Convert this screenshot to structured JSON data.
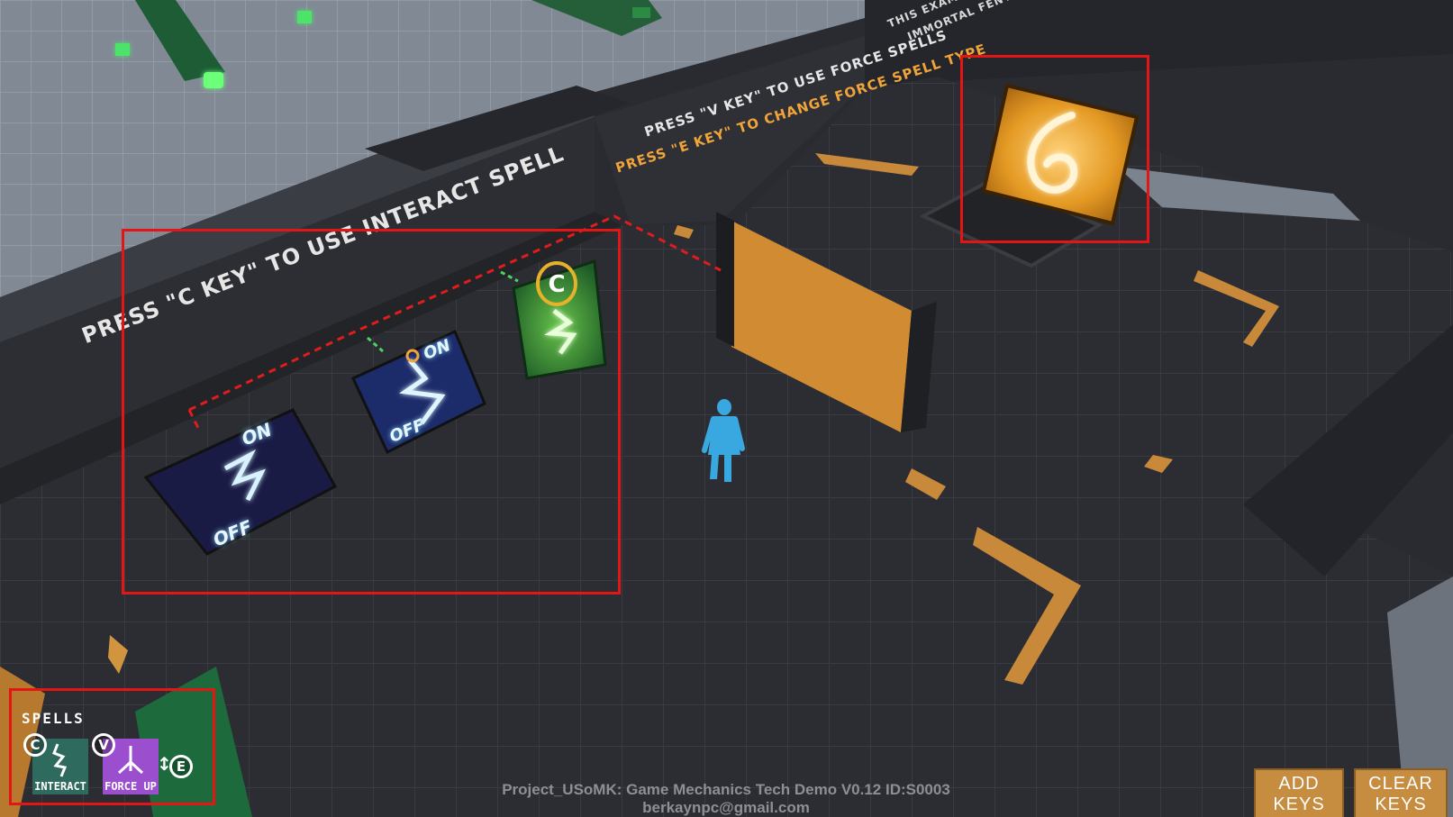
{
  "wall_signs": {
    "interact_instruction": "PRESS \"C KEY\" TO USE INTERACT SPELL",
    "force_instruction": "PRESS \"V KEY\" TO USE FORCE SPELLS",
    "change_instruction": "PRESS \"E KEY\" TO CHANGE FORCE SPELL TYPE",
    "example_line_1": "THIS EXAMPLE",
    "example_line_2": "IMMORTAL FENYX R"
  },
  "switch_panels": [
    {
      "on_label": "ON",
      "off_label": "OFF",
      "state": "off"
    },
    {
      "on_label": "ON",
      "off_label": "OFF",
      "state": "on"
    },
    {
      "state": "active",
      "key_prompt": "C"
    }
  ],
  "rune_glyph": "G",
  "hud": {
    "spells_title": "SPELLS",
    "interact_key": "C",
    "interact_label": "INTERACT",
    "force_key": "V",
    "force_label": "FORCE UP",
    "change_key": "E"
  },
  "footer": {
    "line1": "Project_USoMK: Game Mechanics Tech Demo V0.12 ID:S0003",
    "line2": "berkaynpc@gmail.com"
  },
  "buttons": {
    "add_keys_line1": "ADD",
    "add_keys_line2": "KEYS",
    "clear_keys_line1": "CLEAR",
    "clear_keys_line2": "KEYS"
  },
  "colors": {
    "highlight_box": "#e31515",
    "accent_orange": "#f0a43a",
    "switch_glow": "#7fd4ff",
    "active_green": "#7dff6a",
    "character_blue": "#3aa8e0"
  }
}
